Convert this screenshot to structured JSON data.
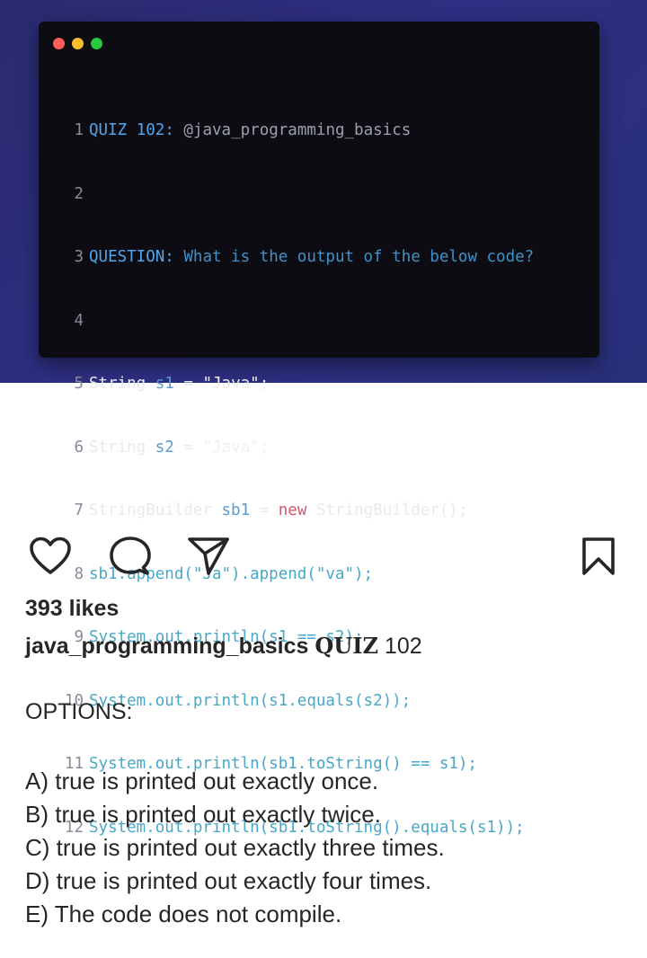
{
  "code_window": {
    "dots": [
      "#ff5f56",
      "#ffbd2e",
      "#27c93f"
    ],
    "lines": [
      {
        "n": "1",
        "label": "QUIZ",
        "num": "102",
        "colon": ":",
        "handle": "@java_programming_basics"
      },
      {
        "n": "2"
      },
      {
        "n": "3",
        "label": "QUESTION:",
        "text": "What is the output of the below code?"
      },
      {
        "n": "4"
      },
      {
        "n": "5",
        "code": [
          "String",
          "s1",
          "=",
          "\"Java\";"
        ]
      },
      {
        "n": "6",
        "code": [
          "String",
          "s2",
          "=",
          "\"Java\";"
        ]
      },
      {
        "n": "7",
        "code": [
          "StringBuilder",
          "sb1",
          "=",
          "new",
          "StringBuilder();"
        ]
      },
      {
        "n": "8",
        "code": [
          "sb1.append(\"Ja\").append(\"va\");"
        ]
      },
      {
        "n": "9",
        "code": [
          "System.out.println(s1 == s2);"
        ]
      },
      {
        "n": "10",
        "code": [
          "System.out.println(s1.equals(s2));"
        ]
      },
      {
        "n": "11",
        "code": [
          "System.out.println(sb1.toString() == s1);"
        ]
      },
      {
        "n": "12",
        "code": [
          "System.out.println(sb1.toString().equals(s1));"
        ]
      }
    ]
  },
  "actions": {
    "like": "heart-icon",
    "comment": "comment-bubble-icon",
    "share": "paper-plane-icon",
    "save": "bookmark-icon"
  },
  "post": {
    "likes": "393 likes",
    "username": "java_programming_basics",
    "caption_quiz": "QUIZ",
    "caption_num": "102",
    "options_heading": "OPTIONS:",
    "options": [
      "A) true is printed out exactly once.",
      "B) true is printed out exactly twice.",
      "C) true is printed out exactly three times.",
      "D) true is printed out exactly four times.",
      "E) The code does not compile."
    ]
  }
}
